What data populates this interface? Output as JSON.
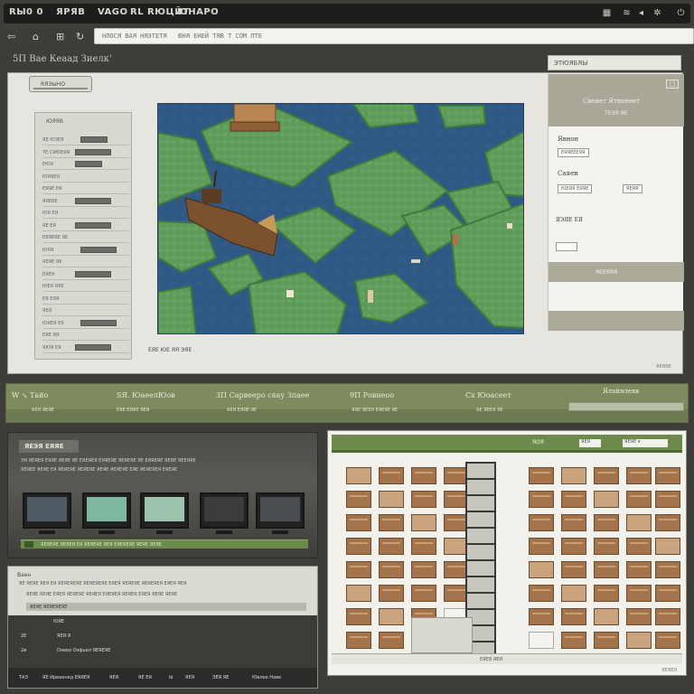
{
  "topbar": {
    "items": [
      "RЫ0 0",
      "ЯPЯВ",
      "VAGO",
      "RL RЮЦЙТ",
      "ЮНАРО"
    ],
    "icons": [
      "grid-icon",
      "wifi-icon",
      "volume-icon",
      "settings-icon",
      "power-icon"
    ]
  },
  "toolbar": {
    "address": "НЛОСЯ ВАЯ НЯЭТЕТЯ   ЮНЯ ЕНЕЙ ТЯВ Т СОМ ПТЕ"
  },
  "page": {
    "title": "5П Вае Кеаад Зиелк'",
    "settings_button": "ЭТЮЯБЯЫ"
  },
  "left_panel": {
    "layer_button": "RЯЭЫНО",
    "heading": "ЮЯЯВ",
    "rows": [
      {
        "label": "ЯЕ ЮЗЕЯ",
        "field": true
      },
      {
        "label": "ТЕ СЯЮЕЯЯ",
        "field": true
      },
      {
        "label": "ЕЮЯ",
        "field": true
      },
      {
        "label": "ЮЯЯЕЯ",
        "field": false
      },
      {
        "label": "ЕЯЯЕ ЕЯ",
        "field": false
      },
      {
        "label": "ЯЯЕВЕ",
        "field": true
      },
      {
        "label": "ЮЯ ЕЯ",
        "field": false
      },
      {
        "label": "ЯЕ ЕЯ",
        "field": true
      },
      {
        "label": "ЕЯЯЕЯЕ ЯЕ",
        "field": false
      },
      {
        "label": "ЮЯЯ",
        "field": true
      },
      {
        "label": "ЯЕЯЕ ЯЕ",
        "field": false
      },
      {
        "label": "ЕЯЕЯ",
        "field": true
      },
      {
        "label": "ЮЕЯ ЯЯЕ",
        "field": false
      },
      {
        "label": "ЕЯ ЕЯЯ",
        "field": false
      },
      {
        "label": "ЯЕЯ",
        "field": false
      },
      {
        "label": "ЮЯЕЯ ЕЯ",
        "field": true
      },
      {
        "label": "ЕЯЕ ЯЯ",
        "field": false
      },
      {
        "label": "ЯЮЯ ЕЯ",
        "field": true
      }
    ]
  },
  "viewport": {
    "status": "ЕЯЕ ЮЕ ЯЯ ЭЯЕ"
  },
  "right_panel": {
    "header_title": "Свенет Ятноееет",
    "header_sub": "ТЕЭЯ ЯЕ",
    "close": "□",
    "label1": "Явнон",
    "label2": "Саяен",
    "chips": [
      "ЕЯЯЕЕЕЯЯ",
      "ЮЕЯЯ ЕЯЯЕ",
      "ЯЕЯЯ"
    ],
    "label3": "ЯЭЯЕ ЕЯ",
    "band_label": "ЯЕЕЯЯЯ"
  },
  "main_footer": "ЯЕЯЯЕ",
  "greenbar": {
    "columns": [
      {
        "title": "W ↘ Тайо",
        "sub": "ЯЕЯ ЯЕЯЕ"
      },
      {
        "title": "SЯ. ЮаеелЮов",
        "sub": "ЕЯЕ ЕЯЯЕ ЯЕЯ"
      },
      {
        "title": "3П Сарвееро сяау Зпаее",
        "sub": "ЯЕЯ ЕЯЯЕ ЯЕ"
      },
      {
        "title": "9П Ровнеоо",
        "sub": "ЯЯЕ ЯЕЕЯ ЕЯЕЯЕ ЯЕ"
      },
      {
        "title": "Сх Юоасеет",
        "sub": "ЯЕ ЯЕЕЯ ЯЕ"
      }
    ],
    "right_title": "Ялайнлевв"
  },
  "devices_panel": {
    "title": "ЯЕЭЯ ЕЯЯЕ",
    "lines": [
      "ЭЯ ЯЕЯЕЯ ЕЯЯЕ ЯЕЯЕ ЯЕ ЕЯЕЯЕЯ ЕЯЯЕЯЕ ЯЕЯЕЯЕ ЯЕ ЕЯЯЕЯЕ ЯЕЯЕ ЯЕЕЯЯЕ",
      "ЯЕЯЕЕ ЯЕЯЕ ЕЯ ЯЕЯЕЯЕ ЯЕЯЕЯЕ ЯЕЯЕ ЯЕЯЕЯЕ ЕЯЕ ЯЕЯЕЯЕЯ ЕЯЕЯЕ"
    ],
    "monitors": [
      {
        "screen": "#4e5a64"
      },
      {
        "screen": "#7fb9a0"
      },
      {
        "screen": "#9fc4ad"
      },
      {
        "screen": "#3c3c3c"
      },
      {
        "screen": "#4a4e52"
      }
    ],
    "footer": "ЯЕЯЕЯЕ ЯЕЯЕЯ ЕЯ ЯЕЯЕЯЕ ЯЕЯ ЕЯЕЯЕЯЕ ЯЕЯЕ ЯЕЯЕ"
  },
  "console_panel": {
    "heading": "Ваен",
    "lines": [
      "ЯЕ ЯЕЯЕ ЯЕЯ ЕЯ ЯЕЯЕЯЕЯЕ ЯЕЯЕЯЕЯЕ ЕЯЕЯ ЯЕЯЕЯЕ ЯЕЯЕЯЕЯ ЕЯЕЯ ЯЕЯ",
      "ЯЕЯЕ ЯЕЯЕ ЕЯЕЯ ЯЕЯЕЯЕ ЯЕЯЕЯ ЕЯЕЯЕЯ ЯЕЯЕЯ ЕЯЕЯ ЯЕЯЕ ЯЕЯЕ"
    ],
    "highlight": "ЯЕЯЕ ЯЕЯЕЯЕЯЕ",
    "items": [
      {
        "k": "",
        "v": "ЮЯЕ"
      },
      {
        "k": "2Е",
        "v": "ЯЕЯ Я"
      },
      {
        "k": "2ø",
        "v": "Ояеео Оэфьел ЯЕЯЕЯЕ"
      }
    ],
    "bottom": [
      "ТАЭ",
      "ЯЕ Ирееенед ЕЯЯЕЯ",
      "ЯЕЯ",
      "ЯЕ ЕЯ",
      "Ы",
      "ЯЕЯ",
      "ЭЕЯ ЯЕ",
      "Ювлее Наве"
    ]
  },
  "inventory_panel": {
    "header_label": "ЯОЯ",
    "field": "ЯЕЯ",
    "select": "ЯЕЯЕ ▾",
    "bottom_label": "ЕЯЕЯ ЯЕЯ",
    "footer": "ЯЕЯЕЯ"
  }
}
